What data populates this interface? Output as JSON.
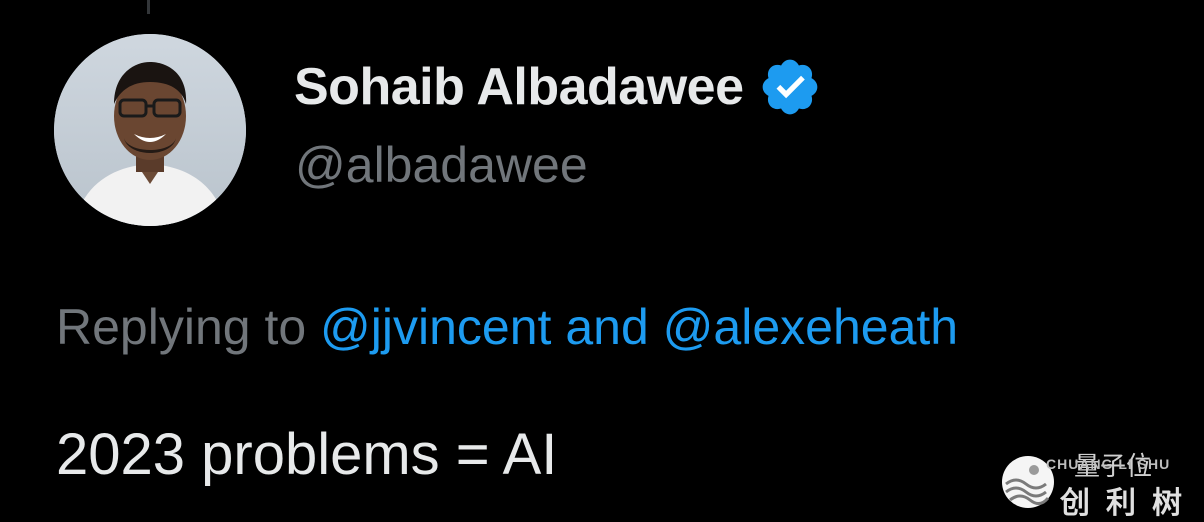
{
  "tweet": {
    "author": {
      "display_name": "Sohaib Albadawee",
      "handle": "@albadawee",
      "verified": true,
      "avatar_icon": "profile-photo"
    },
    "reply": {
      "prefix": "Replying to ",
      "mention_1": "@jjvincent",
      "joiner": " and ",
      "mention_2": "@alexeheath"
    },
    "text": "2023 problems = AI"
  },
  "watermark": {
    "top_text": "量子位",
    "latin_text": "CHUANG LI SHU",
    "cn_text": "创利树",
    "logo_icon": "waves-logo"
  },
  "colors": {
    "background": "#000000",
    "primary_text": "#e7e9ea",
    "secondary_text": "#71767b",
    "accent": "#1d9bf0"
  }
}
